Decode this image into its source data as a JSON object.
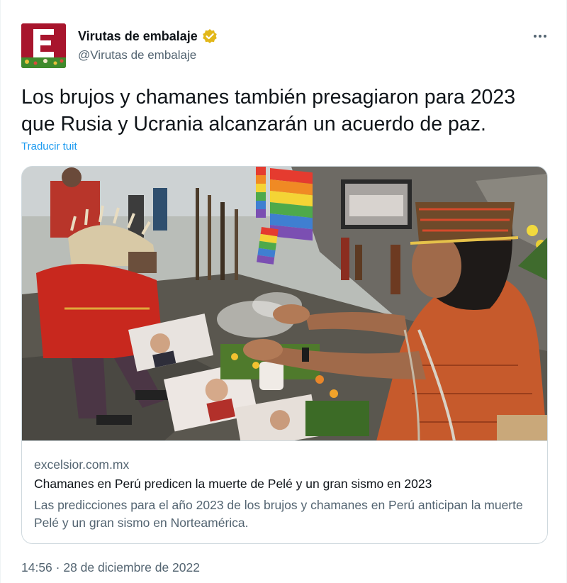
{
  "author": {
    "name": "Virutas de embalaje",
    "handle": "@Virutas de embalaje",
    "avatar_letter": "E",
    "avatar_color": "#a8152d",
    "verified_icon": "verified-badge-icon",
    "verified_color": "#e2b719"
  },
  "menu": {
    "icon": "more-options-icon"
  },
  "tweet": {
    "text": "Los brujos y chamanes también presagiaron para 2023 que Rusia y Ucrania alcanzarán un acuerdo de paz.",
    "translate_label": "Traducir tuit"
  },
  "card": {
    "domain": "excelsior.com.mx",
    "title": "Chamanes en Perú predicen la muerte de Pelé y un gran sismo en 2023",
    "description": "Las predicciones para el año 2023 de los brujos y chamanes en Perú anticipan la muerte Pelé y un gran sismo en Norteamérica."
  },
  "meta": {
    "timestamp": "14:56 · 28 de diciembre de 2022"
  },
  "colors": {
    "link": "#1d9bf0",
    "secondary_text": "#536471",
    "border": "#cfd9de"
  }
}
